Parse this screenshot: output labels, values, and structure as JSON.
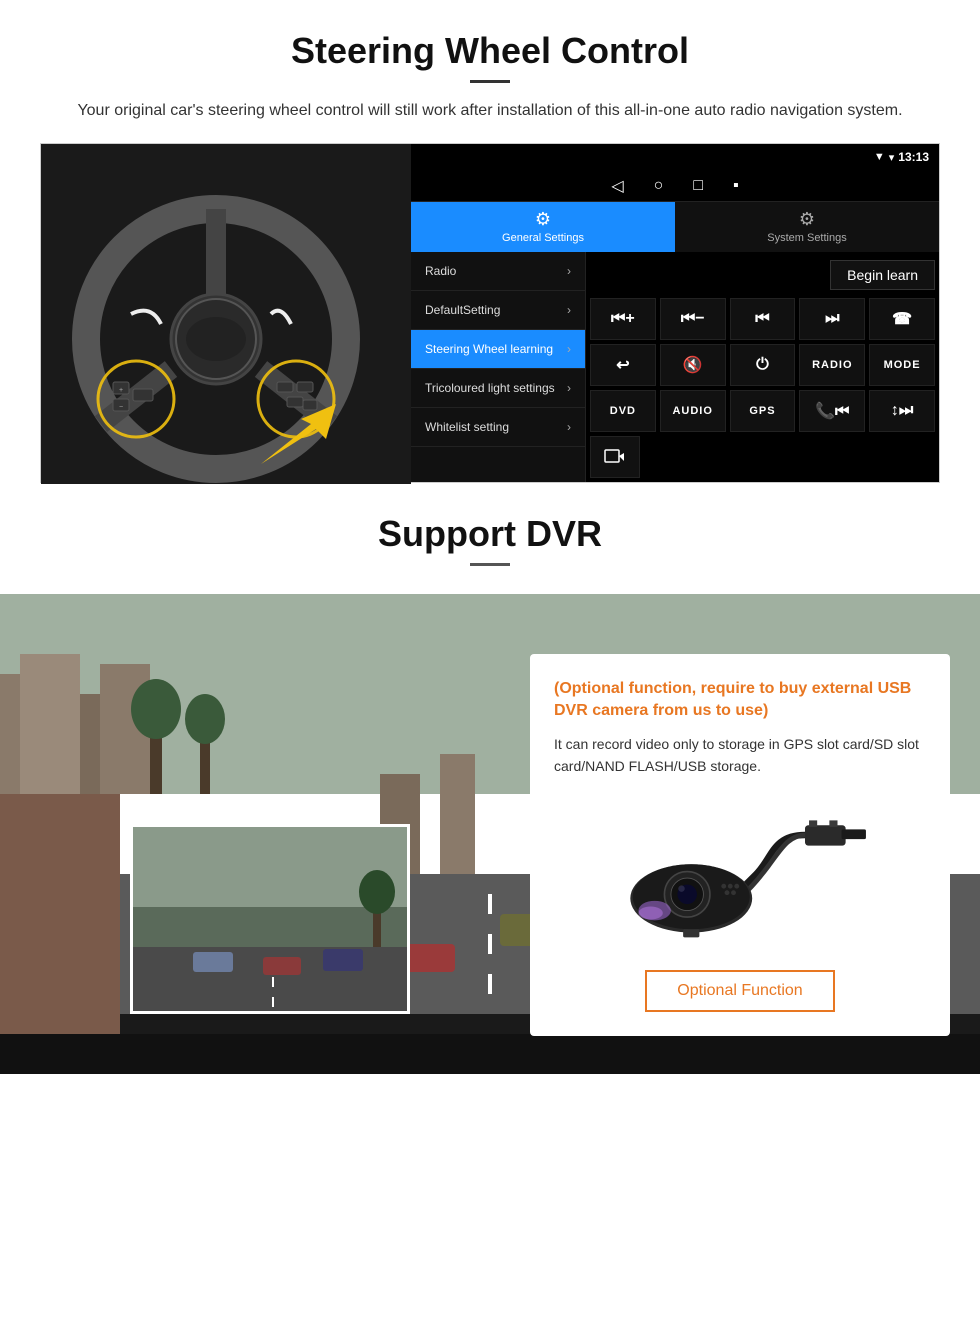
{
  "steering": {
    "title": "Steering Wheel Control",
    "description": "Your original car's steering wheel control will still work after installation of this all-in-one auto radio navigation system.",
    "android": {
      "status_bar": {
        "signal_icon": "▼",
        "wifi_icon": "▾",
        "time": "13:13"
      },
      "nav_buttons": [
        "◁",
        "○",
        "□",
        "▪"
      ],
      "tabs": [
        {
          "icon": "⚙",
          "label": "General Settings",
          "active": true
        },
        {
          "icon": "⚙",
          "label": "System Settings",
          "active": false
        }
      ],
      "menu_items": [
        {
          "label": "Radio",
          "active": false
        },
        {
          "label": "DefaultSetting",
          "active": false
        },
        {
          "label": "Steering Wheel learning",
          "active": true
        },
        {
          "label": "Tricoloured light settings",
          "active": false
        },
        {
          "label": "Whitelist setting",
          "active": false
        }
      ],
      "begin_learn": "Begin learn",
      "control_buttons": [
        [
          "⏮+",
          "⏮−",
          "⏮⏮",
          "⏭⏭",
          "☎"
        ],
        [
          "↩",
          "🔇",
          "⏻",
          "RADIO",
          "MODE"
        ],
        [
          "DVD",
          "AUDIO",
          "GPS",
          "📞⏮",
          "↕⏭"
        ]
      ]
    }
  },
  "dvr": {
    "title": "Support DVR",
    "optional_text": "(Optional function, require to buy external USB DVR camera from us to use)",
    "description": "It can record video only to storage in GPS slot card/SD slot card/NAND FLASH/USB storage.",
    "optional_button_label": "Optional Function"
  }
}
